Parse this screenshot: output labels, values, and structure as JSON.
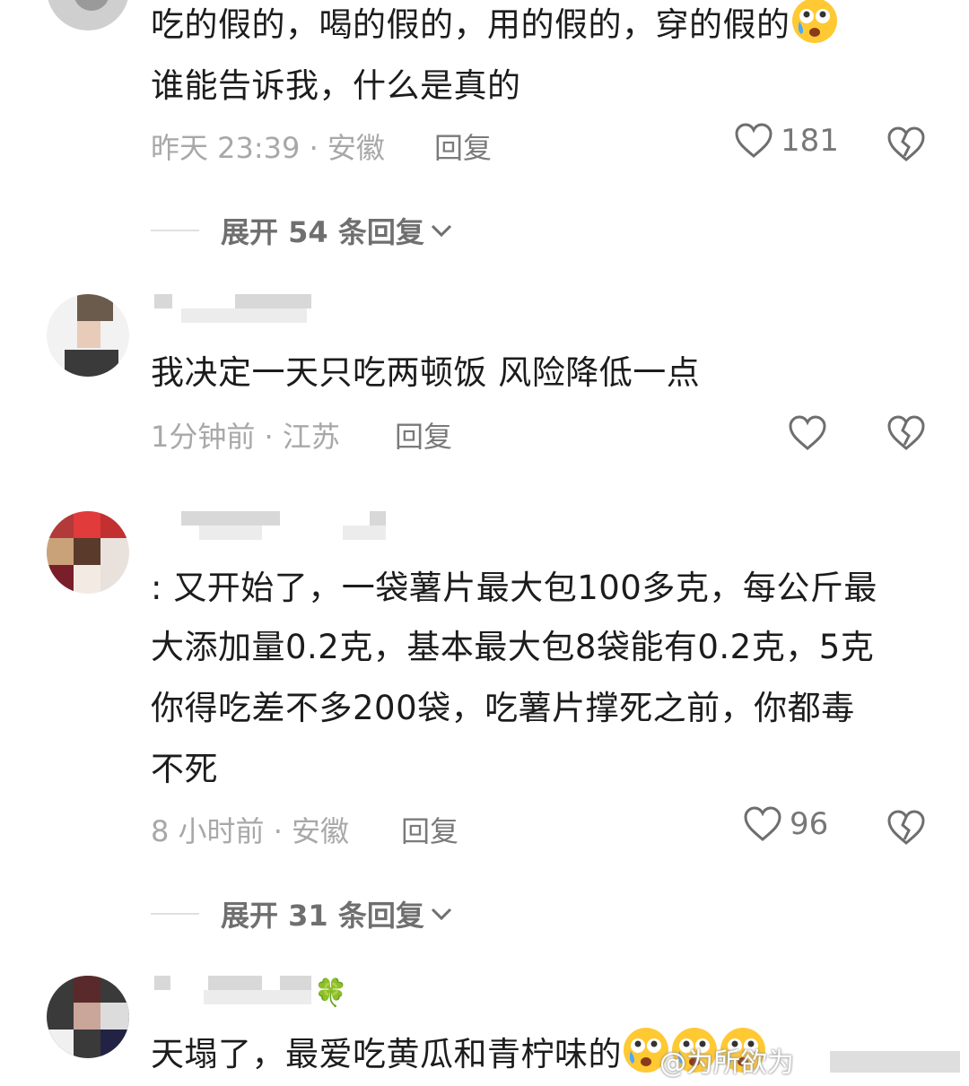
{
  "comments": [
    {
      "text_lines": [
        "吃的假的，喝的假的，用的假的，穿的假的",
        "谁能告诉我，什么是真的"
      ],
      "time_location": "昨天 23:39 · 安徽",
      "reply_label": "回复",
      "likes": "181",
      "expand_label": "展开 54 条回复"
    },
    {
      "text_lines": [
        "我决定一天只吃两顿饭 风险降低一点"
      ],
      "time_location": "1分钟前 · 江苏",
      "reply_label": "回复",
      "likes": ""
    },
    {
      "text_lines": [
        ": 又开始了，一袋薯片最大包100多克，每公斤最",
        "大添加量0.2克，基本最大包8袋能有0.2克，5克",
        "你得吃差不多200袋，吃薯片撑死之前，你都毒",
        "不死"
      ],
      "time_location": "8 小时前 · 安徽",
      "reply_label": "回复",
      "likes": "96",
      "expand_label": "展开 31 条回复"
    },
    {
      "text_lines": [
        "天塌了，最爱吃黄瓜和青柠味的"
      ],
      "username_emoji": "🍀"
    }
  ],
  "watermark": "@为所欲为",
  "icons": [
    "heart-icon",
    "dislike-heart-icon",
    "chevron-down-icon",
    "crying-emoji-icon",
    "clover-icon"
  ],
  "colors": {
    "meta": "#a8a8a8",
    "reply": "#7a7a7a",
    "text": "#1c1c1c"
  }
}
